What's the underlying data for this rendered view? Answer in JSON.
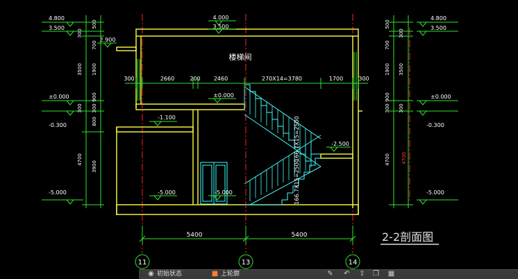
{
  "drawing": {
    "room_label": "楼梯间",
    "section_title": "2-2剖面图",
    "axes": [
      {
        "label": "11"
      },
      {
        "label": "13"
      },
      {
        "label": "14"
      }
    ],
    "bottom_dims": [
      "5400",
      "5400"
    ],
    "top_dims": [
      "300",
      "2660",
      "200",
      "2460",
      "270X14=3780",
      "1700",
      "300"
    ],
    "left_levels": [
      "4.800",
      "3.500",
      "±0.000",
      "-0.300",
      "-5.000"
    ],
    "right_levels": [
      "4.800",
      "3.500",
      "±0.000",
      "-0.300",
      "-5.000"
    ],
    "left_dims": [
      "500",
      "300",
      "700",
      "1900",
      "3500",
      "900",
      "300",
      "300",
      "800",
      "3900",
      "4700"
    ],
    "right_dims": [
      "500",
      "300",
      "700",
      "1900",
      "3500",
      "900",
      "300",
      "300",
      "4700"
    ],
    "roof_dims": [
      "4.000",
      "3.500"
    ],
    "inner_levels": {
      "ledge": "2.900",
      "floor_upper": "±0.000",
      "floor_mid": "-1.100",
      "landing": "-2.500",
      "floor_left": "-5.000",
      "floor_center": "-5.000"
    },
    "stair_dims": [
      "166.7X15=2500",
      "166.7X15=2500"
    ],
    "right_vertical": "4700"
  },
  "toolbar": {
    "item1": "初始状态",
    "item2": "上轮廓"
  },
  "colors": {
    "background": "#000000",
    "grid_red": "#ff2020",
    "line_green": "#2fe62f",
    "wall_yellow": "#ffff40",
    "stair_cyan": "#40ffff",
    "text_white": "#ffffff",
    "section_title": "#e0e0e0"
  }
}
